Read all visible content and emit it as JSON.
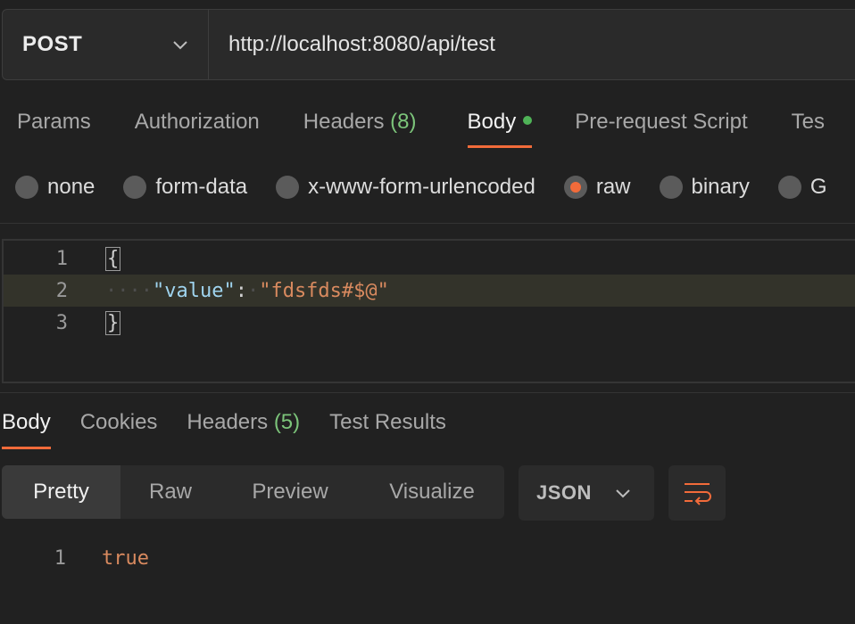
{
  "request": {
    "method": "POST",
    "url": "http://localhost:8080/api/test"
  },
  "request_tabs": [
    {
      "label": "Params"
    },
    {
      "label": "Authorization"
    },
    {
      "label": "Headers",
      "count": "(8)"
    },
    {
      "label": "Body",
      "active": true
    },
    {
      "label": "Pre-request Script"
    },
    {
      "label": "Tes"
    }
  ],
  "body_types": [
    {
      "label": "none"
    },
    {
      "label": "form-data"
    },
    {
      "label": "x-www-form-urlencoded"
    },
    {
      "label": "raw",
      "checked": true
    },
    {
      "label": "binary"
    },
    {
      "label": "G"
    }
  ],
  "editor": {
    "lines": [
      {
        "num": "1",
        "open_brace": "{"
      },
      {
        "num": "2",
        "indent": "····",
        "key": "\"value\"",
        "colon": ":",
        "sep": "·",
        "value": "\"fdsfds#$@\""
      },
      {
        "num": "3",
        "close_brace": "}"
      }
    ]
  },
  "response_tabs": [
    {
      "label": "Body",
      "active": true
    },
    {
      "label": "Cookies"
    },
    {
      "label": "Headers",
      "count": "(5)"
    },
    {
      "label": "Test Results"
    }
  ],
  "view_modes": [
    {
      "label": "Pretty",
      "active": true
    },
    {
      "label": "Raw"
    },
    {
      "label": "Preview"
    },
    {
      "label": "Visualize"
    }
  ],
  "format": "JSON",
  "response": {
    "lines": [
      {
        "num": "1",
        "text": "true"
      }
    ]
  },
  "colors": {
    "accent": "#f26b3a",
    "count_green": "#7cc47a",
    "dot_green": "#4fb357",
    "json_key": "#9fd4ef",
    "json_string": "#d98a5f"
  }
}
